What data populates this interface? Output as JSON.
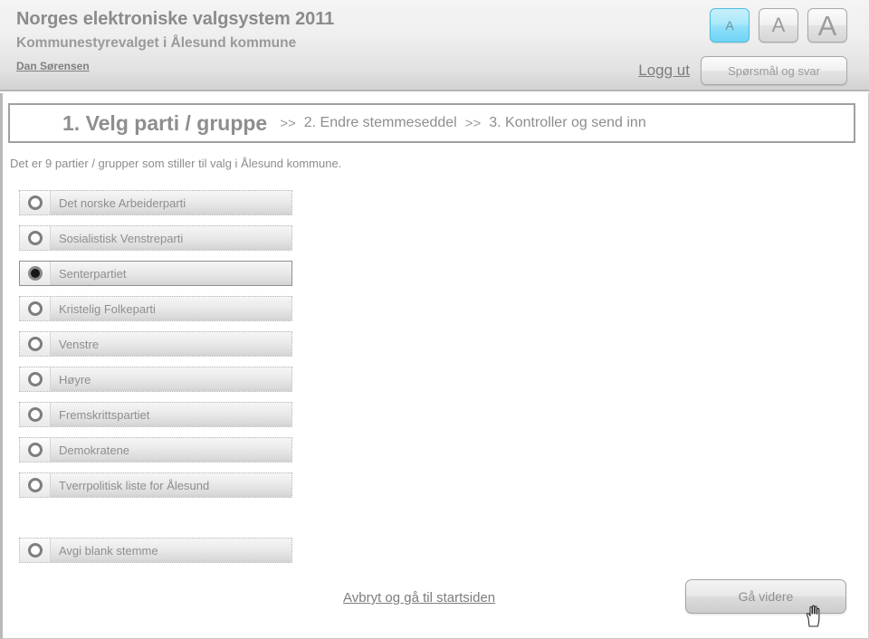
{
  "header": {
    "site_title": "Norges elektroniske valgsystem 2011",
    "election_title": "Kommunestyrevalget i Ålesund kommune",
    "user_name": "Dan Sørensen",
    "logout_label": "Logg ut",
    "faq_label": "Spørsmål og svar",
    "fontsize_buttons": [
      {
        "label": "A",
        "size": "small",
        "selected": true
      },
      {
        "label": "A",
        "size": "medium",
        "selected": false
      },
      {
        "label": "A",
        "size": "large",
        "selected": false
      }
    ],
    "accent_color": "#8fdff9"
  },
  "steps": {
    "separator": ">>",
    "items": [
      {
        "label": "1. Velg parti / gruppe",
        "active": true
      },
      {
        "label": "2. Endre stemmeseddel",
        "active": false
      },
      {
        "label": "3. Kontroller og send inn",
        "active": false
      }
    ]
  },
  "main": {
    "intro_text": "Det er 9 partier / grupper som stiller til valg i Ålesund kommune.",
    "party_count": 9,
    "parties": [
      {
        "name": "Det norske Arbeiderparti",
        "selected": false
      },
      {
        "name": "Sosialistisk Venstreparti",
        "selected": false
      },
      {
        "name": "Senterpartiet",
        "selected": true
      },
      {
        "name": "Kristelig Folkeparti",
        "selected": false
      },
      {
        "name": "Venstre",
        "selected": false
      },
      {
        "name": "Høyre",
        "selected": false
      },
      {
        "name": "Fremskrittspartiet",
        "selected": false
      },
      {
        "name": "Demokratene",
        "selected": false
      },
      {
        "name": "Tverrpolitisk liste for Ålesund",
        "selected": false
      }
    ],
    "blank_vote": {
      "name": "Avgi blank stemme",
      "selected": false
    }
  },
  "footer": {
    "cancel_label": "Avbryt og gå til startsiden",
    "next_label": "Gå videre"
  }
}
